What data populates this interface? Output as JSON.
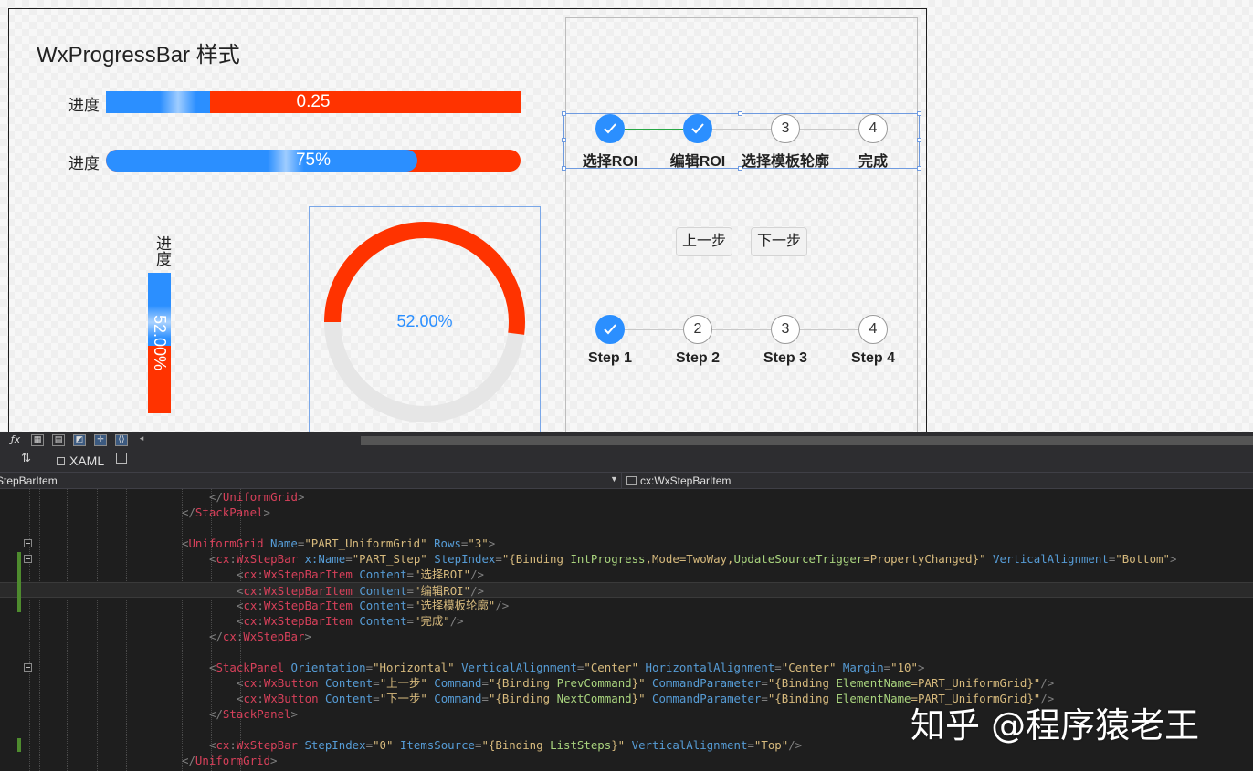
{
  "designer": {
    "title": "WxProgressBar 样式",
    "bar1": {
      "label": "进度",
      "value_text": "0.25",
      "value": 0.25
    },
    "bar2": {
      "label": "进度",
      "value_text": "75%",
      "value": 0.75
    },
    "vbar": {
      "label": "进度",
      "value_text": "52.00%",
      "value": 0.52
    },
    "ring": {
      "value_text": "52.00%",
      "value": 0.52
    },
    "step_bar_top": {
      "step_index": 2,
      "items": [
        {
          "label": "选择ROI",
          "number": "1"
        },
        {
          "label": "编辑ROI",
          "number": "2"
        },
        {
          "label": "选择模板轮廓",
          "number": "3"
        },
        {
          "label": "完成",
          "number": "4"
        }
      ]
    },
    "buttons": {
      "prev": "上一步",
      "next": "下一步"
    },
    "step_bar_bottom": {
      "step_index": 1,
      "items": [
        {
          "label": "Step 1",
          "number": "1"
        },
        {
          "label": "Step 2",
          "number": "2"
        },
        {
          "label": "Step 3",
          "number": "3"
        },
        {
          "label": "Step 4",
          "number": "4"
        }
      ]
    },
    "colors": {
      "primary": "#2b8fff",
      "track": "#ff3300",
      "ring_track": "#e6e6e6",
      "done_line": "#28a745"
    }
  },
  "editor": {
    "toolbar_icons": [
      "fx",
      "grid",
      "snap-grid",
      "artboard",
      "snap-lines",
      "code"
    ],
    "tab_label": "XAML",
    "nav_left": "StepBarItem",
    "nav_right": "cx:WxStepBarItem",
    "lines": [
      {
        "indent": 4,
        "tokens": [
          [
            "p",
            "</"
          ],
          [
            "t",
            "UniformGrid"
          ],
          [
            "p",
            ">"
          ]
        ]
      },
      {
        "indent": 0,
        "tokens": [
          [
            "p",
            "</"
          ],
          [
            "t",
            "StackPanel"
          ],
          [
            "p",
            ">"
          ]
        ]
      },
      {
        "indent": 0,
        "tokens": []
      },
      {
        "indent": 0,
        "tokens": [
          [
            "p",
            "<"
          ],
          [
            "t",
            "UniformGrid"
          ],
          [
            "c",
            " "
          ],
          [
            "n",
            "Name"
          ],
          [
            "p",
            "="
          ],
          [
            "s",
            "\"PART_UniformGrid\""
          ],
          [
            "c",
            " "
          ],
          [
            "n",
            "Rows"
          ],
          [
            "p",
            "="
          ],
          [
            "s",
            "\"3\""
          ],
          [
            "p",
            ">"
          ]
        ]
      },
      {
        "indent": 4,
        "tokens": [
          [
            "p",
            "<"
          ],
          [
            "t",
            "cx"
          ],
          [
            "p",
            ":"
          ],
          [
            "t",
            "WxStepBar"
          ],
          [
            "c",
            " "
          ],
          [
            "n",
            "x:Name"
          ],
          [
            "p",
            "="
          ],
          [
            "s",
            "\"PART_Step\""
          ],
          [
            "c",
            " "
          ],
          [
            "n",
            "StepIndex"
          ],
          [
            "p",
            "="
          ],
          [
            "s",
            "\"{Binding "
          ],
          [
            "e",
            "IntProgress"
          ],
          [
            "s",
            ",Mode=TwoWay,"
          ],
          [
            "e",
            "UpdateSourceTrigger"
          ],
          [
            "s",
            "=PropertyChanged}\""
          ],
          [
            "c",
            " "
          ],
          [
            "n",
            "VerticalAlignment"
          ],
          [
            "p",
            "="
          ],
          [
            "s",
            "\"Bottom\""
          ],
          [
            "p",
            ">"
          ]
        ]
      },
      {
        "indent": 8,
        "tokens": [
          [
            "p",
            "<"
          ],
          [
            "t",
            "cx"
          ],
          [
            "p",
            ":"
          ],
          [
            "t",
            "WxStepBarItem"
          ],
          [
            "c",
            " "
          ],
          [
            "n",
            "Content"
          ],
          [
            "p",
            "="
          ],
          [
            "s",
            "\"选择ROI\""
          ],
          [
            "p",
            "/>"
          ]
        ]
      },
      {
        "indent": 8,
        "tokens": [
          [
            "p",
            "<"
          ],
          [
            "t",
            "cx"
          ],
          [
            "p",
            ":"
          ],
          [
            "t",
            "WxStepBarItem"
          ],
          [
            "c",
            " "
          ],
          [
            "n",
            "Content"
          ],
          [
            "p",
            "="
          ],
          [
            "s",
            "\"编辑ROI\""
          ],
          [
            "p",
            "/>"
          ]
        ]
      },
      {
        "indent": 8,
        "tokens": [
          [
            "p",
            "<"
          ],
          [
            "t",
            "cx"
          ],
          [
            "p",
            ":"
          ],
          [
            "t",
            "WxStepBarItem"
          ],
          [
            "c",
            " "
          ],
          [
            "n",
            "Content"
          ],
          [
            "p",
            "="
          ],
          [
            "s",
            "\"选择模板轮廓\""
          ],
          [
            "p",
            "/>"
          ]
        ]
      },
      {
        "indent": 8,
        "tokens": [
          [
            "p",
            "<"
          ],
          [
            "t",
            "cx"
          ],
          [
            "p",
            ":"
          ],
          [
            "t",
            "WxStepBarItem"
          ],
          [
            "c",
            " "
          ],
          [
            "n",
            "Content"
          ],
          [
            "p",
            "="
          ],
          [
            "s",
            "\"完成\""
          ],
          [
            "p",
            "/>"
          ]
        ]
      },
      {
        "indent": 4,
        "tokens": [
          [
            "p",
            "</"
          ],
          [
            "t",
            "cx"
          ],
          [
            "p",
            ":"
          ],
          [
            "t",
            "WxStepBar"
          ],
          [
            "p",
            ">"
          ]
        ]
      },
      {
        "indent": 0,
        "tokens": []
      },
      {
        "indent": 4,
        "tokens": [
          [
            "p",
            "<"
          ],
          [
            "t",
            "StackPanel"
          ],
          [
            "c",
            " "
          ],
          [
            "n",
            "Orientation"
          ],
          [
            "p",
            "="
          ],
          [
            "s",
            "\"Horizontal\""
          ],
          [
            "c",
            " "
          ],
          [
            "n",
            "VerticalAlignment"
          ],
          [
            "p",
            "="
          ],
          [
            "s",
            "\"Center\""
          ],
          [
            "c",
            " "
          ],
          [
            "n",
            "HorizontalAlignment"
          ],
          [
            "p",
            "="
          ],
          [
            "s",
            "\"Center\""
          ],
          [
            "c",
            " "
          ],
          [
            "n",
            "Margin"
          ],
          [
            "p",
            "="
          ],
          [
            "s",
            "\"10\""
          ],
          [
            "p",
            ">"
          ]
        ]
      },
      {
        "indent": 8,
        "tokens": [
          [
            "p",
            "<"
          ],
          [
            "t",
            "cx"
          ],
          [
            "p",
            ":"
          ],
          [
            "t",
            "WxButton"
          ],
          [
            "c",
            " "
          ],
          [
            "n",
            "Content"
          ],
          [
            "p",
            "="
          ],
          [
            "s",
            "\"上一步\""
          ],
          [
            "c",
            " "
          ],
          [
            "n",
            "Command"
          ],
          [
            "p",
            "="
          ],
          [
            "s",
            "\"{Binding "
          ],
          [
            "e",
            "PrevCommand"
          ],
          [
            "s",
            "}\""
          ],
          [
            "c",
            " "
          ],
          [
            "n",
            "CommandParameter"
          ],
          [
            "p",
            "="
          ],
          [
            "s",
            "\"{Binding "
          ],
          [
            "e",
            "ElementName"
          ],
          [
            "s",
            "=PART_UniformGrid}\""
          ],
          [
            "p",
            "/>"
          ]
        ]
      },
      {
        "indent": 8,
        "tokens": [
          [
            "p",
            "<"
          ],
          [
            "t",
            "cx"
          ],
          [
            "p",
            ":"
          ],
          [
            "t",
            "WxButton"
          ],
          [
            "c",
            " "
          ],
          [
            "n",
            "Content"
          ],
          [
            "p",
            "="
          ],
          [
            "s",
            "\"下一步\""
          ],
          [
            "c",
            " "
          ],
          [
            "n",
            "Command"
          ],
          [
            "p",
            "="
          ],
          [
            "s",
            "\"{Binding "
          ],
          [
            "e",
            "NextCommand"
          ],
          [
            "s",
            "}\""
          ],
          [
            "c",
            " "
          ],
          [
            "n",
            "CommandParameter"
          ],
          [
            "p",
            "="
          ],
          [
            "s",
            "\"{Binding "
          ],
          [
            "e",
            "ElementName"
          ],
          [
            "s",
            "=PART_UniformGrid}\""
          ],
          [
            "p",
            "/>"
          ]
        ]
      },
      {
        "indent": 4,
        "tokens": [
          [
            "p",
            "</"
          ],
          [
            "t",
            "StackPanel"
          ],
          [
            "p",
            ">"
          ]
        ]
      },
      {
        "indent": 0,
        "tokens": []
      },
      {
        "indent": 4,
        "tokens": [
          [
            "p",
            "<"
          ],
          [
            "t",
            "cx"
          ],
          [
            "p",
            ":"
          ],
          [
            "t",
            "WxStepBar"
          ],
          [
            "c",
            " "
          ],
          [
            "n",
            "StepIndex"
          ],
          [
            "p",
            "="
          ],
          [
            "s",
            "\"0\""
          ],
          [
            "c",
            " "
          ],
          [
            "n",
            "ItemsSource"
          ],
          [
            "p",
            "="
          ],
          [
            "s",
            "\"{Binding "
          ],
          [
            "e",
            "ListSteps"
          ],
          [
            "s",
            "}\""
          ],
          [
            "c",
            " "
          ],
          [
            "n",
            "VerticalAlignment"
          ],
          [
            "p",
            "="
          ],
          [
            "s",
            "\"Top\""
          ],
          [
            "p",
            "/>"
          ]
        ]
      },
      {
        "indent": 0,
        "tokens": [
          [
            "p",
            "</"
          ],
          [
            "t",
            "UniformGrid"
          ],
          [
            "p",
            ">"
          ]
        ]
      }
    ]
  },
  "watermark": "知乎 @程序猿老王"
}
